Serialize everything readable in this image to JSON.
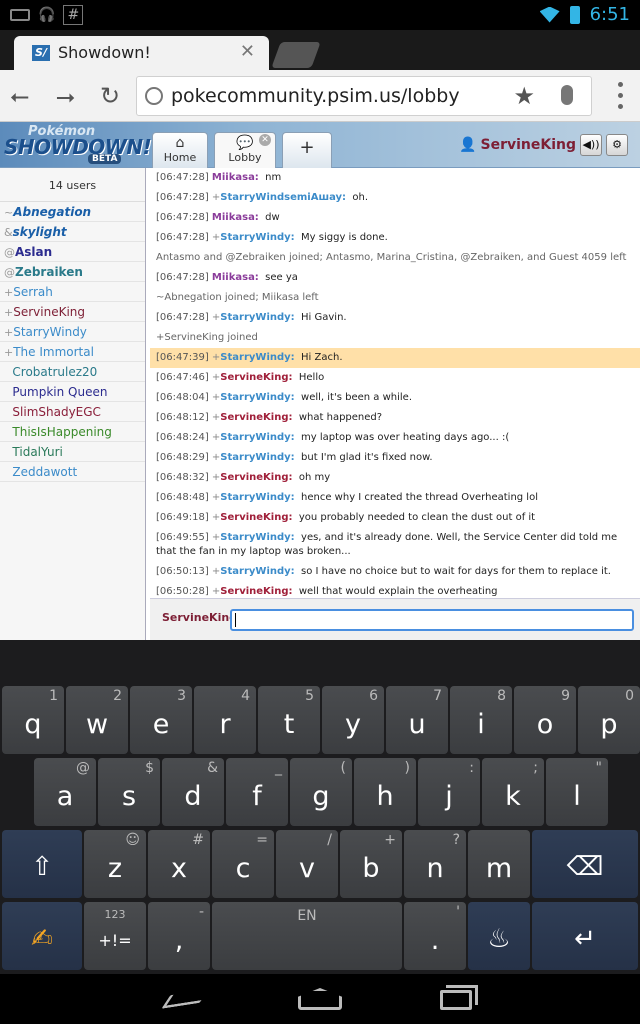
{
  "status_bar": {
    "time": "6:51",
    "hash": "#"
  },
  "browser": {
    "tab_title": "Showdown!",
    "tab_close": "✕",
    "url": "pokecommunity.psim.us/lobby",
    "favicon": "S/"
  },
  "showdown": {
    "logo_top": "Pokémon",
    "logo_main": "SHOWDOWN!",
    "logo_badge": "BETA",
    "tabs": [
      {
        "label": "Home"
      },
      {
        "label": "Lobby"
      },
      {
        "label": "+"
      }
    ],
    "username": "ServineKing",
    "sound_icon": "◀))",
    "settings_icon": "⚙"
  },
  "userlist": {
    "count": "14 users",
    "users": [
      {
        "rank": "~",
        "name": "Abnegation",
        "color": "#1a5fa8",
        "style": "bold-italic"
      },
      {
        "rank": "&",
        "name": "skylight",
        "color": "#1a5fa8",
        "style": "bold-italic"
      },
      {
        "rank": "@",
        "name": "Aslan",
        "color": "#2c2c8f",
        "style": "bold"
      },
      {
        "rank": "@",
        "name": "Zebraiken",
        "color": "#2a7a8a",
        "style": "bold"
      },
      {
        "rank": "+",
        "name": "Serrah",
        "color": "#3b8bc9",
        "style": "normal"
      },
      {
        "rank": "+",
        "name": "ServineKing",
        "color": "#7d1f35",
        "style": "normal"
      },
      {
        "rank": "+",
        "name": "StarryWindy",
        "color": "#3b8bc9",
        "style": "normal"
      },
      {
        "rank": "+",
        "name": "The Immortal",
        "color": "#3b8bc9",
        "style": "normal"
      },
      {
        "rank": "",
        "name": "Crobatrulez20",
        "color": "#2a7a8a",
        "style": "normal"
      },
      {
        "rank": "",
        "name": "Pumpkin Queen",
        "color": "#2c2c8f",
        "style": "normal"
      },
      {
        "rank": "",
        "name": "SlimShadyEGC",
        "color": "#8a1f3a",
        "style": "normal"
      },
      {
        "rank": "",
        "name": "ThisIsHappening",
        "color": "#3a8a2a",
        "style": "normal"
      },
      {
        "rank": "",
        "name": "TidalYuri",
        "color": "#2a7a5a",
        "style": "normal"
      },
      {
        "rank": "",
        "name": "Zeddawott",
        "color": "#3b8bc9",
        "style": "normal"
      }
    ]
  },
  "chat": {
    "messages": [
      {
        "ts": "[06:47:28]",
        "rank": "",
        "name": "Miikasa:",
        "color": "#8a3b9a",
        "text": "nm"
      },
      {
        "ts": "[06:47:28]",
        "rank": "+",
        "name": "StarryWindsemiAшay:",
        "color": "#3b8bc9",
        "text": "oh."
      },
      {
        "ts": "[06:47:28]",
        "rank": "",
        "name": "Miikasa:",
        "color": "#8a3b9a",
        "text": "dw"
      },
      {
        "ts": "[06:47:28]",
        "rank": "+",
        "name": "StarryWindy:",
        "color": "#3b8bc9",
        "text": "My siggy is done."
      },
      {
        "notice": "Antasmo and @Zebraiken joined; Antasmo, Marina_Cristina, @Zebraiken, and Guest 4059 left"
      },
      {
        "ts": "[06:47:28]",
        "rank": "",
        "name": "Miikasa:",
        "color": "#8a3b9a",
        "text": "see ya"
      },
      {
        "notice": "~Abnegation joined; Miikasa left"
      },
      {
        "ts": "[06:47:28]",
        "rank": "+",
        "name": "StarryWindy:",
        "color": "#3b8bc9",
        "text": "Hi Gavin."
      },
      {
        "notice": "+ServineKing joined"
      },
      {
        "ts": "[06:47:39]",
        "rank": "+",
        "name": "StarryWindy:",
        "color": "#3b8bc9",
        "text": "Hi Zach.",
        "highlight": true
      },
      {
        "ts": "[06:47:46]",
        "rank": "+",
        "name": "ServineKing:",
        "color": "#a0203a",
        "text": "Hello"
      },
      {
        "ts": "[06:48:04]",
        "rank": "+",
        "name": "StarryWindy:",
        "color": "#3b8bc9",
        "text": "well, it's been a while."
      },
      {
        "ts": "[06:48:12]",
        "rank": "+",
        "name": "ServineKing:",
        "color": "#a0203a",
        "text": "what happened?"
      },
      {
        "ts": "[06:48:24]",
        "rank": "+",
        "name": "StarryWindy:",
        "color": "#3b8bc9",
        "text": "my laptop was over heating days ago... :("
      },
      {
        "ts": "[06:48:29]",
        "rank": "+",
        "name": "StarryWindy:",
        "color": "#3b8bc9",
        "text": "but I'm glad it's fixed now."
      },
      {
        "ts": "[06:48:32]",
        "rank": "+",
        "name": "ServineKing:",
        "color": "#a0203a",
        "text": "oh my"
      },
      {
        "ts": "[06:48:48]",
        "rank": "+",
        "name": "StarryWindy:",
        "color": "#3b8bc9",
        "text": "hence why I created the thread Overheating lol"
      },
      {
        "ts": "[06:49:18]",
        "rank": "+",
        "name": "ServineKing:",
        "color": "#a0203a",
        "text": "you probably needed to clean the dust out of it"
      },
      {
        "ts": "[06:49:55]",
        "rank": "+",
        "name": "StarryWindy:",
        "color": "#3b8bc9",
        "text": "yes, and it's already done. Well, the Service Center did told me that the fan in my laptop was broken..."
      },
      {
        "ts": "[06:50:13]",
        "rank": "+",
        "name": "StarryWindy:",
        "color": "#3b8bc9",
        "text": "so I have no choice but to wait for days for them to replace it."
      },
      {
        "ts": "[06:50:28]",
        "rank": "+",
        "name": "ServineKing:",
        "color": "#a0203a",
        "text": "well that would explain the overheating"
      }
    ],
    "input_label": "ServineKing:",
    "input_value": ""
  },
  "keyboard": {
    "row1": [
      {
        "k": "q",
        "h": "1"
      },
      {
        "k": "w",
        "h": "2"
      },
      {
        "k": "e",
        "h": "3"
      },
      {
        "k": "r",
        "h": "4"
      },
      {
        "k": "t",
        "h": "5"
      },
      {
        "k": "y",
        "h": "6"
      },
      {
        "k": "u",
        "h": "7"
      },
      {
        "k": "i",
        "h": "8"
      },
      {
        "k": "o",
        "h": "9"
      },
      {
        "k": "p",
        "h": "0"
      }
    ],
    "row2": [
      {
        "k": "a",
        "h": "@"
      },
      {
        "k": "s",
        "h": "$"
      },
      {
        "k": "d",
        "h": "&"
      },
      {
        "k": "f",
        "h": "_"
      },
      {
        "k": "g",
        "h": "("
      },
      {
        "k": "h",
        "h": ")"
      },
      {
        "k": "j",
        "h": ":"
      },
      {
        "k": "k",
        "h": ";"
      },
      {
        "k": "l",
        "h": "\""
      }
    ],
    "row3": [
      {
        "k": "z",
        "h": "!"
      },
      {
        "k": "x",
        "h": "#"
      },
      {
        "k": "c",
        "h": "="
      },
      {
        "k": "v",
        "h": "/"
      },
      {
        "k": "b",
        "h": "+"
      },
      {
        "k": "n",
        "h": "?"
      },
      {
        "k": "m",
        "h": ""
      }
    ],
    "row3_hint_z": "☺",
    "sym_top": "123",
    "sym_label": "+!=",
    "comma": ",",
    "comma_hint": "-",
    "space_label": "EN",
    "period": ".",
    "period_hint": "'"
  }
}
